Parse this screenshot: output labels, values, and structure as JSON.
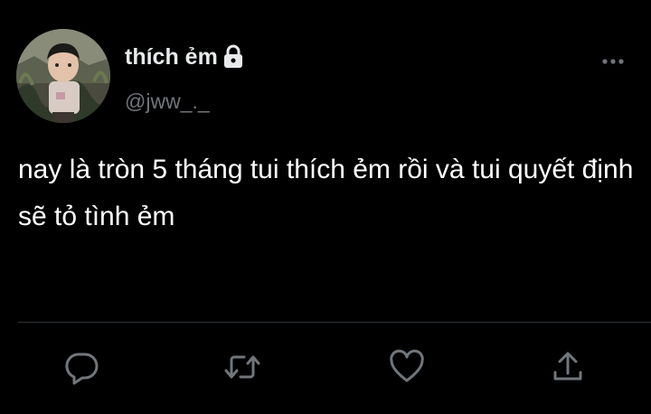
{
  "author": {
    "display_name": "thích ẻm",
    "handle": "@jww_._",
    "protected_icon": "lock-icon",
    "avatar": "profile-photo-child"
  },
  "tweet": {
    "text": "nay là tròn 5 tháng tui thích ẻm rồi và tui quyết định sẽ tỏ tình ẻm"
  },
  "actions": [
    {
      "name": "reply",
      "icon": "speech-bubble-icon"
    },
    {
      "name": "retweet",
      "icon": "retweet-arrows-icon"
    },
    {
      "name": "like",
      "icon": "heart-icon"
    },
    {
      "name": "share",
      "icon": "upload-arrow-icon"
    }
  ],
  "menu": {
    "icon": "more-horizontal-icon"
  },
  "colors": {
    "background": "#000000",
    "text_primary": "#e7e9ea",
    "text_secondary": "#71767b",
    "icon": "#71767b",
    "divider": "#2f3336"
  }
}
